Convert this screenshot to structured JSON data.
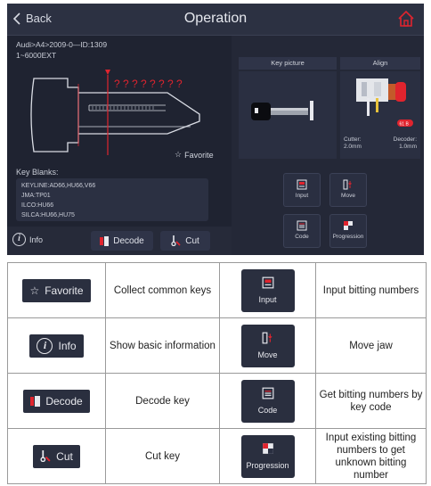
{
  "screen": {
    "back_label": "Back",
    "title": "Operation",
    "vehicle_line1": "Audi>A4>2009-0—ID:1309",
    "vehicle_line2": "1~6000EXT",
    "cut_marks": "? ? ? ? ? ? ? ?",
    "favorite_label": "Favorite",
    "key_blanks_label": "Key Blanks:",
    "key_blanks": [
      "KEYLINE:AD66,HU66,V66",
      "JMA:TP01",
      "ILCO:HU66",
      "SILCA:HU66,HU75"
    ],
    "info_label": "Info",
    "decode_label": "Decode",
    "cut_label": "Cut",
    "key_picture_label": "Key picture",
    "align_label": "Align",
    "align_badge": "61 B",
    "cutter_label": "Cutter:",
    "cutter_value": "2.0mm",
    "decoder_label": "Decoder:",
    "decoder_value": "1.0mm",
    "tiles": {
      "input": "Input",
      "move": "Move",
      "code": "Code",
      "progression": "Progression"
    }
  },
  "legend": {
    "rows": [
      {
        "left_button": "Favorite",
        "left_desc": "Collect common keys",
        "right_button": "Input",
        "right_desc": "Input bitting numbers"
      },
      {
        "left_button": "Info",
        "left_desc": "Show basic information",
        "right_button": "Move",
        "right_desc": "Move jaw"
      },
      {
        "left_button": "Decode",
        "left_desc": "Decode key",
        "right_button": "Code",
        "right_desc": "Get bitting numbers by key code"
      },
      {
        "left_button": "Cut",
        "left_desc": "Cut key",
        "right_button": "Progression",
        "right_desc": "Input existing bitting numbers to get unknown bitting number"
      }
    ]
  },
  "colors": {
    "screen_bg": "#242837",
    "accent_red": "#e0242e",
    "button_bg": "#2a2f3f"
  },
  "icons": [
    "back-chevron-icon",
    "home-icon",
    "star-icon",
    "info-icon",
    "decode-icon",
    "cut-icon",
    "input-icon",
    "move-icon",
    "code-icon",
    "progression-icon"
  ]
}
